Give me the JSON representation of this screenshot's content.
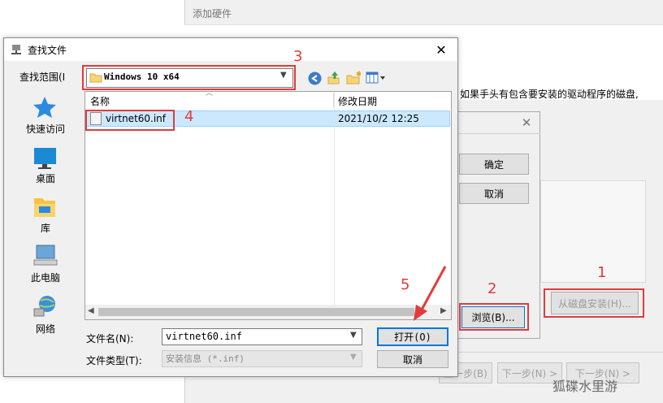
{
  "hardware_wizard": {
    "title": "添加硬件",
    "prompt": "如果手头有包含要安装的驱动程序的磁盘,",
    "back_label": "上一步(B)",
    "next_label_1": "下一步(N) >",
    "next_label_2": "下一步(N) >"
  },
  "disk_dialog": {
    "ok_label": "确定",
    "cancel_label": "取消",
    "browse_label": "浏览(B)...",
    "from_disk_label": "从磁盘安装(H)..."
  },
  "find_file": {
    "title": "查找文件",
    "look_in_label": "查找范围(I",
    "look_in_value": "Windows 10 x64",
    "places": [
      {
        "label": "快速访问",
        "icon": "star-icon"
      },
      {
        "label": "桌面",
        "icon": "desktop-icon"
      },
      {
        "label": "库",
        "icon": "library-icon"
      },
      {
        "label": "此电脑",
        "icon": "computer-icon"
      },
      {
        "label": "网络",
        "icon": "network-icon"
      }
    ],
    "columns": {
      "name": "名称",
      "date": "修改日期"
    },
    "files": [
      {
        "name": "virtnet60.inf",
        "date": "2021/10/2 12:25"
      }
    ],
    "file_name_label": "文件名(N):",
    "file_name_value": "virtnet60.inf",
    "file_type_label": "文件类型(T):",
    "file_type_value": "安装信息 (*.inf)",
    "open_label": "打开(O)",
    "cancel_label": "取消"
  },
  "annotations": {
    "step1": "1",
    "step2": "2",
    "step3": "3",
    "step4": "4",
    "step5": "5"
  },
  "watermark": "狐碟水里游",
  "colors": {
    "annotation": "#e23b3b",
    "selection": "#cce8ff",
    "accent": "#0078d7"
  }
}
